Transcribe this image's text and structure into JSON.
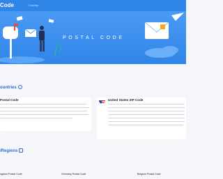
{
  "header": {
    "logo": "Code",
    "nav_country": "Country"
  },
  "hero": {
    "title": "POSTAL CODE"
  },
  "sections": {
    "countries_title": "ountries",
    "regions_title": "/Regions"
  },
  "cards": [
    {
      "title": "Postal Code",
      "lines": [
        "Website has been providing professional postal code inquiry",
        "services for more than 10 years, including arbitrary address postal code",
        "ry in China, international postal code inquiry. It has also added the",
        "ction of geographic location service, street office inquiry, resident",
        "ng inquiry, point of interest search by an address, etc."
      ]
    },
    {
      "title": "United States ZIP Code",
      "lines": [
        "This website focuses on U.S. zip codes and contains every",
        "U.S. zip codes. In addition to zip codes, you can also find",
        "information related to zip codes, such as the population, ra",
        "economic and social characteristics of a particular zip code",
        "the site also provides some search tools to help people find",
        "from different aspects, such as access to geocoding to find",
        "student addresses, zip code distance calculator, and other"
      ]
    }
  ],
  "regions": [
    {
      "label": "ngdom Postal Code"
    },
    {
      "label": "Germany Postal Code"
    },
    {
      "label": "Belgium Postal Code"
    }
  ],
  "colors": {
    "brand_blue": "#2f86e6",
    "section_blue": "#2c6fd1",
    "background": "#f4f6f9"
  }
}
